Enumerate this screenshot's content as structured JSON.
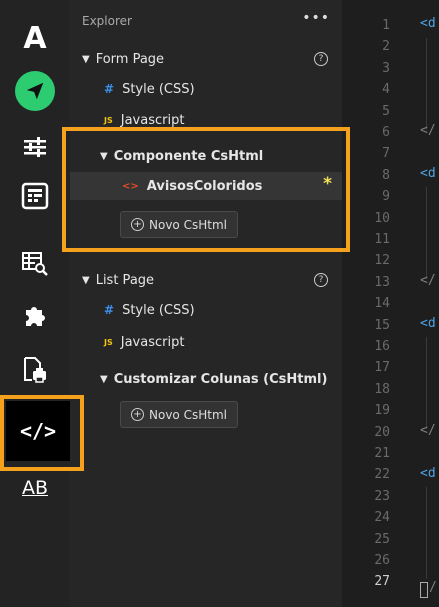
{
  "activity_bar": {
    "items": [
      {
        "name": "app-logo-icon"
      },
      {
        "name": "send-icon"
      },
      {
        "name": "sliders-icon"
      },
      {
        "name": "form-icon"
      },
      {
        "name": "table-search-icon"
      },
      {
        "name": "puzzle-icon"
      },
      {
        "name": "file-print-icon"
      },
      {
        "name": "code-icon"
      },
      {
        "name": "text-format-icon"
      }
    ],
    "logo_text": "A",
    "code_label": "</>",
    "ab_label": "AB",
    "highlight_color": "#f4a11d",
    "accent_green": "#2ecc71"
  },
  "explorer": {
    "title": "Explorer",
    "more": "•••",
    "form_page": {
      "label": "Form Page",
      "style": "Style (CSS)",
      "javascript": "Javascript",
      "component": {
        "label": "Componente CsHtml",
        "selected_item": "AvisosColoridos",
        "modified_marker": "*",
        "new_button": "Novo CsHtml"
      }
    },
    "list_page": {
      "label": "List Page",
      "style": "Style (CSS)",
      "javascript": "Javascript",
      "custom_columns": {
        "label": "Customizar Colunas (CsHtml)",
        "new_button": "Novo CsHtml"
      }
    },
    "icons": {
      "js": "JS",
      "hash": "#",
      "html": "<>",
      "help": "?",
      "plus": "+",
      "triangle": "▼"
    }
  },
  "editor": {
    "line_numbers": [
      "1",
      "2",
      "3",
      "4",
      "5",
      "6",
      "7",
      "8",
      "9",
      "10",
      "11",
      "12",
      "13",
      "14",
      "15",
      "16",
      "17",
      "18",
      "19",
      "20",
      "21",
      "22",
      "23",
      "24",
      "25",
      "26",
      "27"
    ],
    "active_line": "27",
    "code_fragments": {
      "line1": "<d",
      "line6": "</",
      "line8": "<d",
      "line13": "</",
      "line15": "<d",
      "line20": "</",
      "line22": "<d",
      "line27": "/"
    }
  }
}
